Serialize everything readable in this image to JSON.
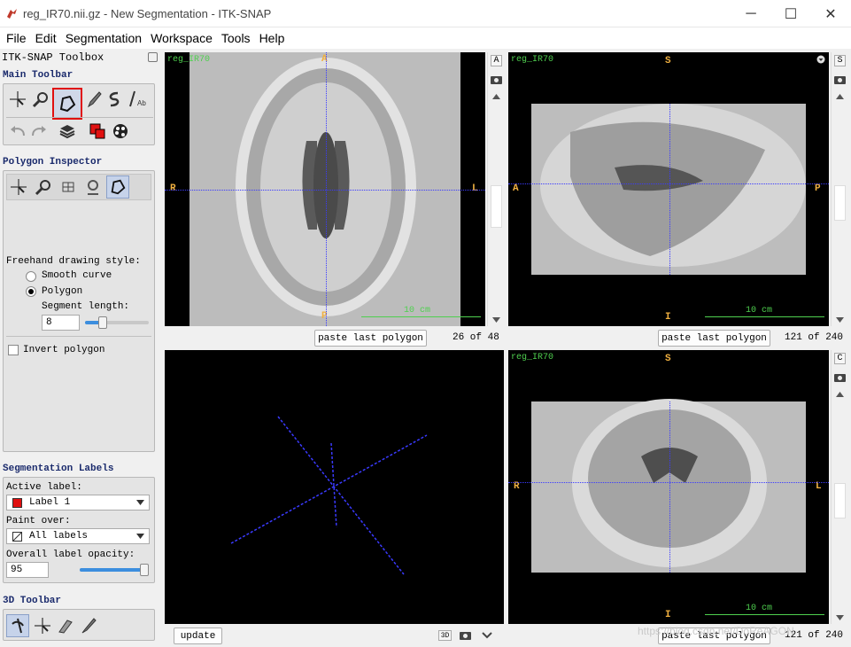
{
  "window": {
    "title": "reg_IR70.nii.gz - New Segmentation - ITK-SNAP",
    "minimize": "─",
    "maximize": "☐",
    "close": "✕"
  },
  "menu": [
    "File",
    "Edit",
    "Segmentation",
    "Workspace",
    "Tools",
    "Help"
  ],
  "toolbox": {
    "title": "ITK-SNAP Toolbox",
    "main_toolbar": "Main Toolbar",
    "polygon_inspector": "Polygon Inspector",
    "freehand_style": "Freehand drawing style:",
    "smooth_curve": "Smooth curve",
    "polygon": "Polygon",
    "segment_length_label": "Segment length:",
    "segment_length": "8",
    "segment_length_fraction": 0.28,
    "invert_polygon": "Invert polygon",
    "seg_labels": "Segmentation Labels",
    "active_label_caption": "Active label:",
    "active_label": "Label 1",
    "active_label_color": "#e01010",
    "paint_over_caption": "Paint over:",
    "paint_over": "All labels",
    "opacity_caption": "Overall label opacity:",
    "opacity": "95",
    "opacity_fraction": 0.95,
    "toolbar_3d": "3D Toolbar"
  },
  "views": {
    "axial": {
      "name": "reg_IR70",
      "top": "A",
      "bottom": "P",
      "left": "R",
      "right": "L",
      "scale": "10 cm",
      "side_button": "A",
      "paste": "paste last polygon",
      "slice": "26 of 48"
    },
    "sagittal": {
      "name": "reg_IR70",
      "top": "S",
      "bottom": "I",
      "left": "A",
      "right": "P",
      "scale": "10 cm",
      "side_button": "S",
      "paste": "paste last polygon",
      "slice": "121 of 240"
    },
    "coronal": {
      "name": "reg_IR70",
      "top": "S",
      "bottom": "I",
      "left": "R",
      "right": "L",
      "scale": "10 cm",
      "side_button": "C",
      "paste": "paste last polygon",
      "slice": "121 of 240"
    },
    "render3d": {
      "update": "update",
      "badge": "3D"
    }
  },
  "watermark": "https://blog.csdn.net/DoReAGON",
  "colors": {
    "crosshair": "#3a3aff",
    "orientation": "#f0b040",
    "view_name": "#4fd04f",
    "highlight": "#e01010"
  }
}
